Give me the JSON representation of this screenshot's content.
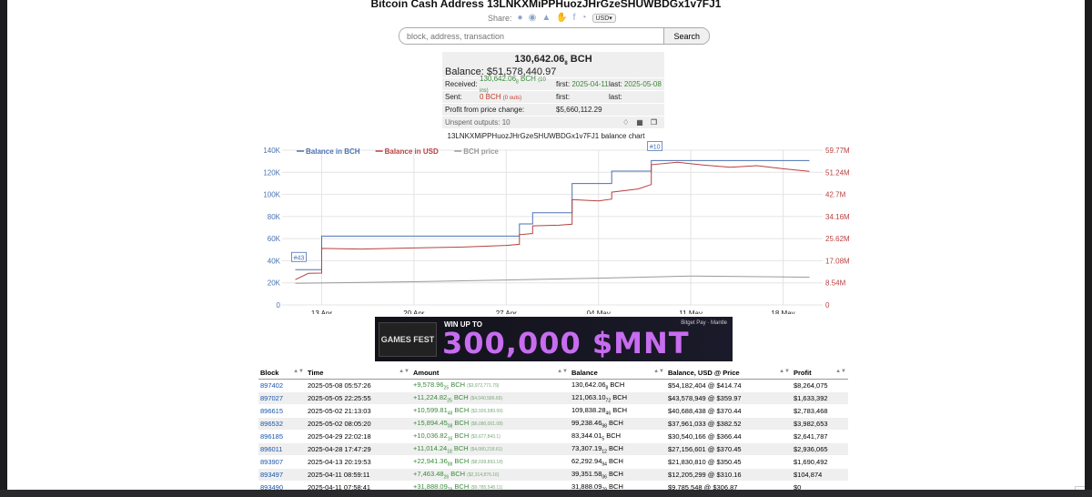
{
  "page_title": "Bitcoin Cash Address 13LNKXMiPPHuozJHrGzeSHUWBDGx1v7FJ1",
  "share": {
    "label": "Share:",
    "icons": [
      "twitter-icon",
      "reddit-icon",
      "vk-icon",
      "like-icon",
      "facebook-icon",
      "weibo-icon"
    ],
    "currency": "USD"
  },
  "search": {
    "placeholder": "block, address, transaction",
    "button": "Search"
  },
  "summary": {
    "amount": "130,642.06",
    "amount_small": "8",
    "amount_unit": " BCH",
    "balance_label": "Balance:",
    "balance_value": "$51,578,440.97",
    "received_label": "Received:",
    "received_value": "130,642.06",
    "received_small": "8",
    "received_unit": " BCH",
    "received_ins": "(10 ins)",
    "first_label": "first:",
    "received_first": "2025-04-11",
    "last_label": "last:",
    "received_last": "2025-05-08",
    "sent_label": "Sent:",
    "sent_value": "0 BCH",
    "sent_outs": "(0 outs)",
    "sent_first": "",
    "sent_last": "",
    "profit_label": "Profit from price change:",
    "profit_value": "$5,660,112.29",
    "unspent_label": "Unspent outputs: 10"
  },
  "chart_data": {
    "type": "line",
    "title": "13LNKXMiPPHuozJHrGzeSHUWBDGx1v7FJ1 balance chart",
    "legend": [
      "Balance in BCH",
      "Balance in USD",
      "BCH price"
    ],
    "legend_placement": "top-left",
    "x_ticks": [
      "13 Apr",
      "20 Apr",
      "27 Apr",
      "04 May",
      "11 May",
      "18 May"
    ],
    "y_left_ticks": [
      "0",
      "20K",
      "40K",
      "60K",
      "80K",
      "100K",
      "120K",
      "140K"
    ],
    "y_right_ticks": [
      "0",
      "8.54M",
      "17.08M",
      "25.62M",
      "34.16M",
      "42.7M",
      "51.24M",
      "59.77M"
    ],
    "ylim_left": [
      0,
      140000
    ],
    "ylim_right": [
      0,
      59770000
    ],
    "flags": [
      {
        "label": "#43",
        "date": "2025-04-11"
      },
      {
        "label": "#10",
        "date": "2025-05-08"
      }
    ],
    "series": [
      {
        "name": "Balance in BCH",
        "color": "#4a72b0",
        "axis": "left",
        "points": [
          [
            "2025-04-11",
            31888
          ],
          [
            "2025-04-13",
            31888
          ],
          [
            "2025-04-13",
            62293
          ],
          [
            "2025-04-28",
            62293
          ],
          [
            "2025-04-28",
            73307
          ],
          [
            "2025-04-29",
            73307
          ],
          [
            "2025-04-29",
            83344
          ],
          [
            "2025-05-02",
            83344
          ],
          [
            "2025-05-02",
            99238
          ],
          [
            "2025-05-02",
            109838
          ],
          [
            "2025-05-05",
            109838
          ],
          [
            "2025-05-05",
            121063
          ],
          [
            "2025-05-08",
            121063
          ],
          [
            "2025-05-08",
            130642
          ],
          [
            "2025-05-20",
            130642
          ]
        ]
      },
      {
        "name": "Balance in USD",
        "color": "#b94040",
        "axis": "right",
        "points": [
          [
            "2025-04-11",
            9785548
          ],
          [
            "2025-04-12",
            12200000
          ],
          [
            "2025-04-13",
            12300000
          ],
          [
            "2025-04-13",
            21830810
          ],
          [
            "2025-04-16",
            21600000
          ],
          [
            "2025-04-20",
            22000000
          ],
          [
            "2025-04-24",
            22400000
          ],
          [
            "2025-04-27",
            23000000
          ],
          [
            "2025-04-28",
            23400000
          ],
          [
            "2025-04-28",
            27156601
          ],
          [
            "2025-04-29",
            27600000
          ],
          [
            "2025-04-29",
            30540166
          ],
          [
            "2025-05-01",
            30800000
          ],
          [
            "2025-05-02",
            31200000
          ],
          [
            "2025-05-02",
            37961033
          ],
          [
            "2025-05-02",
            40688438
          ],
          [
            "2025-05-04",
            40200000
          ],
          [
            "2025-05-05",
            40900000
          ],
          [
            "2025-05-05",
            43578949
          ],
          [
            "2025-05-07",
            44800000
          ],
          [
            "2025-05-08",
            46500000
          ],
          [
            "2025-05-08",
            54182404
          ],
          [
            "2025-05-10",
            55100000
          ],
          [
            "2025-05-12",
            54000000
          ],
          [
            "2025-05-14",
            53200000
          ],
          [
            "2025-05-16",
            53800000
          ],
          [
            "2025-05-18",
            52600000
          ],
          [
            "2025-05-20",
            51578441
          ]
        ]
      },
      {
        "name": "BCH price",
        "color": "#999999",
        "axis": "right",
        "points": [
          [
            "2025-04-11",
            306.87
          ],
          [
            "2025-04-20",
            330
          ],
          [
            "2025-04-27",
            355
          ],
          [
            "2025-05-04",
            380
          ],
          [
            "2025-05-11",
            412
          ],
          [
            "2025-05-20",
            394.8
          ]
        ]
      }
    ]
  },
  "ad": {
    "badge": "GAMES FEST",
    "headline": "WIN UP TO",
    "amount": "300,000 $MNT",
    "logo": "Bitget Pay · Mantle"
  },
  "table": {
    "headers": [
      "Block",
      "Time",
      "Amount",
      "Balance",
      "Balance, USD @ Price",
      "Profit"
    ],
    "rows": [
      {
        "block": "897402",
        "time": "2025-05-08 05:57:26",
        "amount": "+9,578.96",
        "amount_small": "25",
        "amount_usd": "($3,972,771.79)",
        "balance": "130,642.06",
        "balance_small": "8",
        "usd": "$54,182,404 @ $414.74",
        "profit": "$8,264,075"
      },
      {
        "block": "897027",
        "time": "2025-05-05 22:25:55",
        "amount": "+11,224.82",
        "amount_small": "25",
        "amount_usd": "($4,040,586.65)",
        "balance": "121,063.10",
        "balance_small": "72",
        "usd": "$43,578,949 @ $359.97",
        "profit": "$1,633,392"
      },
      {
        "block": "896615",
        "time": "2025-05-02 21:13:03",
        "amount": "+10,599.81",
        "amount_small": "48",
        "amount_usd": "($3,926,589.99)",
        "balance": "109,838.28",
        "balance_small": "46",
        "usd": "$40,688,438 @ $370.44",
        "profit": "$2,783,468"
      },
      {
        "block": "896532",
        "time": "2025-05-02 08:05:20",
        "amount": "+15,894.45",
        "amount_small": "08",
        "amount_usd": "($6,080,001.08)",
        "balance": "99,238.46",
        "balance_small": "98",
        "usd": "$37,961,033 @ $382.52",
        "profit": "$3,982,653"
      },
      {
        "block": "896185",
        "time": "2025-04-29 22:02:18",
        "amount": "+10,036.82",
        "amount_small": "16",
        "amount_usd": "($3,677,843.1)",
        "balance": "83,344.01",
        "balance_small": "5",
        "usd": "$30,540,166 @ $366.44",
        "profit": "$2,641,787"
      },
      {
        "block": "896011",
        "time": "2025-04-28 17:47:29",
        "amount": "+11,014.24",
        "amount_small": "18",
        "amount_usd": "($4,080,218.61)",
        "balance": "73,307.19",
        "balance_small": "12",
        "usd": "$27,156,601 @ $370.45",
        "profit": "$2,936,065"
      },
      {
        "block": "893907",
        "time": "2025-04-13 20:19:53",
        "amount": "+22,941.36",
        "amount_small": "88",
        "amount_usd": "($8,039,893.18)",
        "balance": "62,292.94",
        "balance_small": "94",
        "usd": "$21,830,810 @ $350.45",
        "profit": "$1,690,492"
      },
      {
        "block": "893497",
        "time": "2025-04-11 08:59:11",
        "amount": "+7,463.48",
        "amount_small": "26",
        "amount_usd": "($2,314,876.16)",
        "balance": "39,351.58",
        "balance_small": "06",
        "usd": "$12,205,299 @ $310.16",
        "profit": "$104,874"
      },
      {
        "block": "893490",
        "time": "2025-04-11 07:58:41",
        "amount": "+31,888.09",
        "amount_small": "79",
        "amount_usd": "($9,785,548.11)",
        "balance": "31,888.09",
        "balance_small": "79",
        "usd": "$9,785,548 @ $306.87",
        "profit": "$0"
      }
    ]
  }
}
